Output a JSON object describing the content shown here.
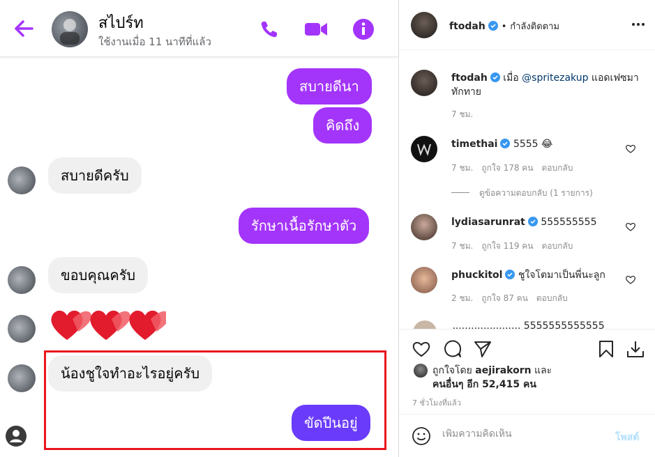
{
  "chat": {
    "contact_name": "สไปร์ท",
    "status": "ใช้งานเมื่อ 11 นาทีที่แล้ว",
    "messages": [
      {
        "text": "สบายดีนา",
        "dir": "out"
      },
      {
        "text": "คิดถึง",
        "dir": "out"
      },
      {
        "text": "สบายดีครับ",
        "dir": "in"
      },
      {
        "text": "รักษาเนื้อรักษาตัว",
        "dir": "out"
      },
      {
        "text": "ขอบคุณครับ",
        "dir": "in"
      },
      {
        "text": "❤️❤️❤️",
        "dir": "in"
      },
      {
        "text": "น้องชูใจทำอะไรอยู่ครับ",
        "dir": "in"
      },
      {
        "text": "ขัดปีนอยู่",
        "dir": "out"
      }
    ],
    "accent_color": "#a334fa",
    "highlight_color": "#e8161c"
  },
  "instagram": {
    "header": {
      "username": "ftodah",
      "separator": "•",
      "follow_state": "กำลังติดตาม"
    },
    "caption": {
      "username": "ftodah",
      "text_pre": "เมื่อ ",
      "mention": "@spritezakup",
      "text_post": " แอดเฟซมาทักทาย",
      "time": "7 ชม."
    },
    "comments": [
      {
        "username": "timethai",
        "text": "5555 😂",
        "time": "7 ชม.",
        "likes": "ถูกใจ 178 คน",
        "reply": "ตอบกลับ"
      },
      {
        "username": "lydiasarunrat",
        "text": "555555555",
        "time": "7 ชม.",
        "likes": "ถูกใจ 119 คน",
        "reply": "ตอบกลับ"
      },
      {
        "username": "phuckitol",
        "text": "ชูใจโตมาเป็นพี่นะลูก",
        "time": "2 ชม.",
        "likes": "ถูกใจ 87 คน",
        "reply": "ตอบกลับ"
      }
    ],
    "view_replies": "ดูข้อความตอบกลับ (1 รายการ)",
    "clipped_comment": "...................... 5555555555555",
    "liked_by_pre": "ถูกใจโดย ",
    "liked_by_user": "aejirakorn",
    "liked_by_post": " และ",
    "liked_by_others": "คนอื่นๆ อีก 52,415 คน",
    "time_ago": "7 ชั่วโมงที่แล้ว",
    "comment_placeholder": "เพิ่มความคิดเห็น",
    "post_label": "โพสต์"
  }
}
